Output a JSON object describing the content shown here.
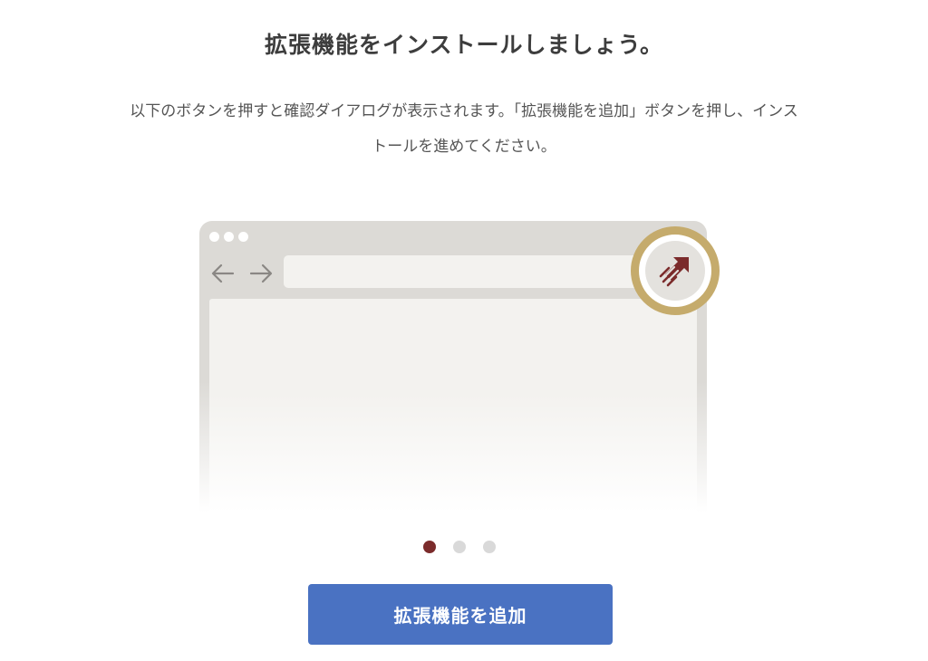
{
  "heading": "拡張機能をインストールしましょう。",
  "description": {
    "line1": "以下のボタンを押すと確認ダイアログが表示されます。「拡張機能を追加」ボタンを押し、インス",
    "line2": "トールを進めてください。"
  },
  "illustration": {
    "icons": [
      "back-arrow-icon",
      "forward-arrow-icon",
      "extension-icon"
    ],
    "colors": {
      "frame": "#dcdad6",
      "ring": "#c5ab6c",
      "extension_icon": "#7b2b2b"
    }
  },
  "carousel": {
    "total": 3,
    "active_index": 0
  },
  "add_button": {
    "label": "拡張機能を追加",
    "color": "#4a72c2"
  }
}
